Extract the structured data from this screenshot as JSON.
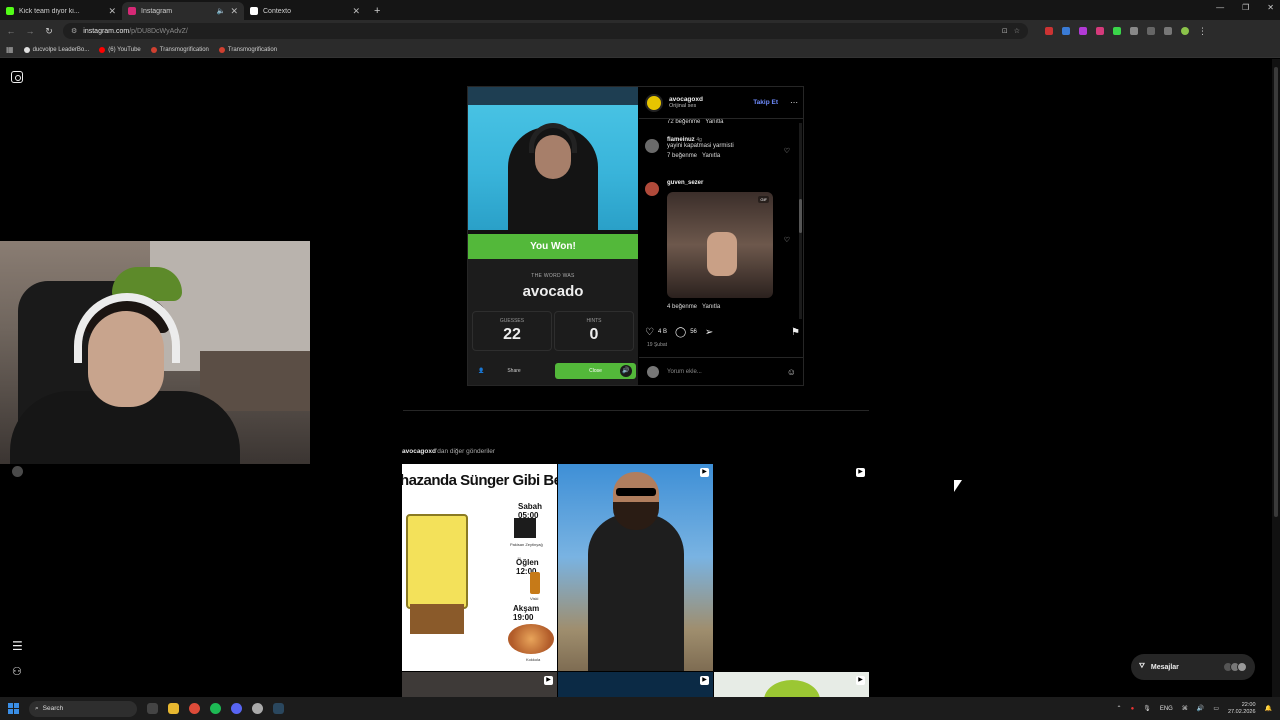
{
  "browser": {
    "tabs": [
      {
        "title": "Kick team diyor ki...",
        "favicon_color": "#53fc18",
        "active": false
      },
      {
        "title": "Instagram",
        "favicon_color": "#d62976",
        "active": true
      },
      {
        "title": "Contexto",
        "favicon_color": "#ffffff",
        "active": false
      }
    ],
    "url_host": "instagram.com",
    "url_path": "/p/DU8DcWyAdvZ/",
    "bookmarks": [
      {
        "label": "ducvolpe LeaderBo...",
        "color": "#e0e0e0"
      },
      {
        "label": "(6) YouTube",
        "color": "#ff0000"
      },
      {
        "label": "Transmogrification",
        "color": "#d04030"
      },
      {
        "label": "Transmogrification",
        "color": "#d04030"
      }
    ]
  },
  "post": {
    "game": {
      "result": "You Won!",
      "word_label": "THE WORD WAS",
      "word": "avocado",
      "guesses_label": "GUESSES",
      "guesses": "22",
      "hints_label": "HINTS",
      "hints": "0",
      "share_label": "Share",
      "close_label": "Close"
    },
    "author": {
      "name": "avocagoxd",
      "audio": "Orijinal ses",
      "follow_label": "Takip Et"
    },
    "comments": [
      {
        "meta": "72 beğenme",
        "reply": "Yanıtla"
      },
      {
        "user": "flameinuz",
        "age": "4g",
        "text": "yayini kapatmasi yarmisti",
        "likes": "7 beğenme",
        "reply": "Yanıtla"
      },
      {
        "user": "guven_sezer",
        "likes": "4 beğenme",
        "reply": "Yanıtla"
      }
    ],
    "like_count": "4 B",
    "comment_count": "56",
    "date": "19 Şubat",
    "add_comment_placeholder": "Yorum ekle..."
  },
  "more_posts": {
    "user": "avocagoxd",
    "suffix": "'dan diğer gönderiler"
  },
  "tile1": {
    "headline": "hazanda Sünger Gibi Besle",
    "morning": "Sabah 05:00",
    "noon": "Öğlen 12:00",
    "evening": "Akşam 19:00",
    "caption1": "Pakisan Zeytinyağ",
    "caption2": "Viski",
    "caption3": "Kokkola"
  },
  "messages_label": "Mesajlar",
  "taskbar": {
    "search_label": "Search",
    "lang": "ENG",
    "time": "22:00",
    "date": "27.02.2026"
  },
  "colors": {
    "accent_green": "#53b83a",
    "link_blue": "#6f8cff"
  }
}
